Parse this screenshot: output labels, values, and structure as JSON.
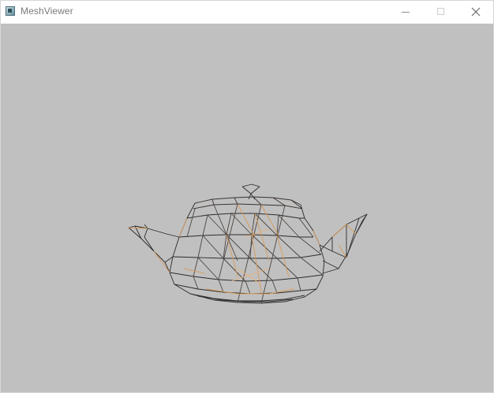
{
  "window": {
    "title": "MeshViewer",
    "icon": "meshviewer-app-icon"
  },
  "caption_buttons": {
    "minimize": "minimize-icon",
    "maximize": "maximize-icon",
    "close": "close-icon"
  },
  "viewport": {
    "background_color": "#c0c0c0",
    "model": "teapot",
    "render_mode": "wireframe",
    "wire_colors": [
      "#2b2b2b",
      "#d99a5a",
      "#e8b27a",
      "#5a5048"
    ]
  }
}
